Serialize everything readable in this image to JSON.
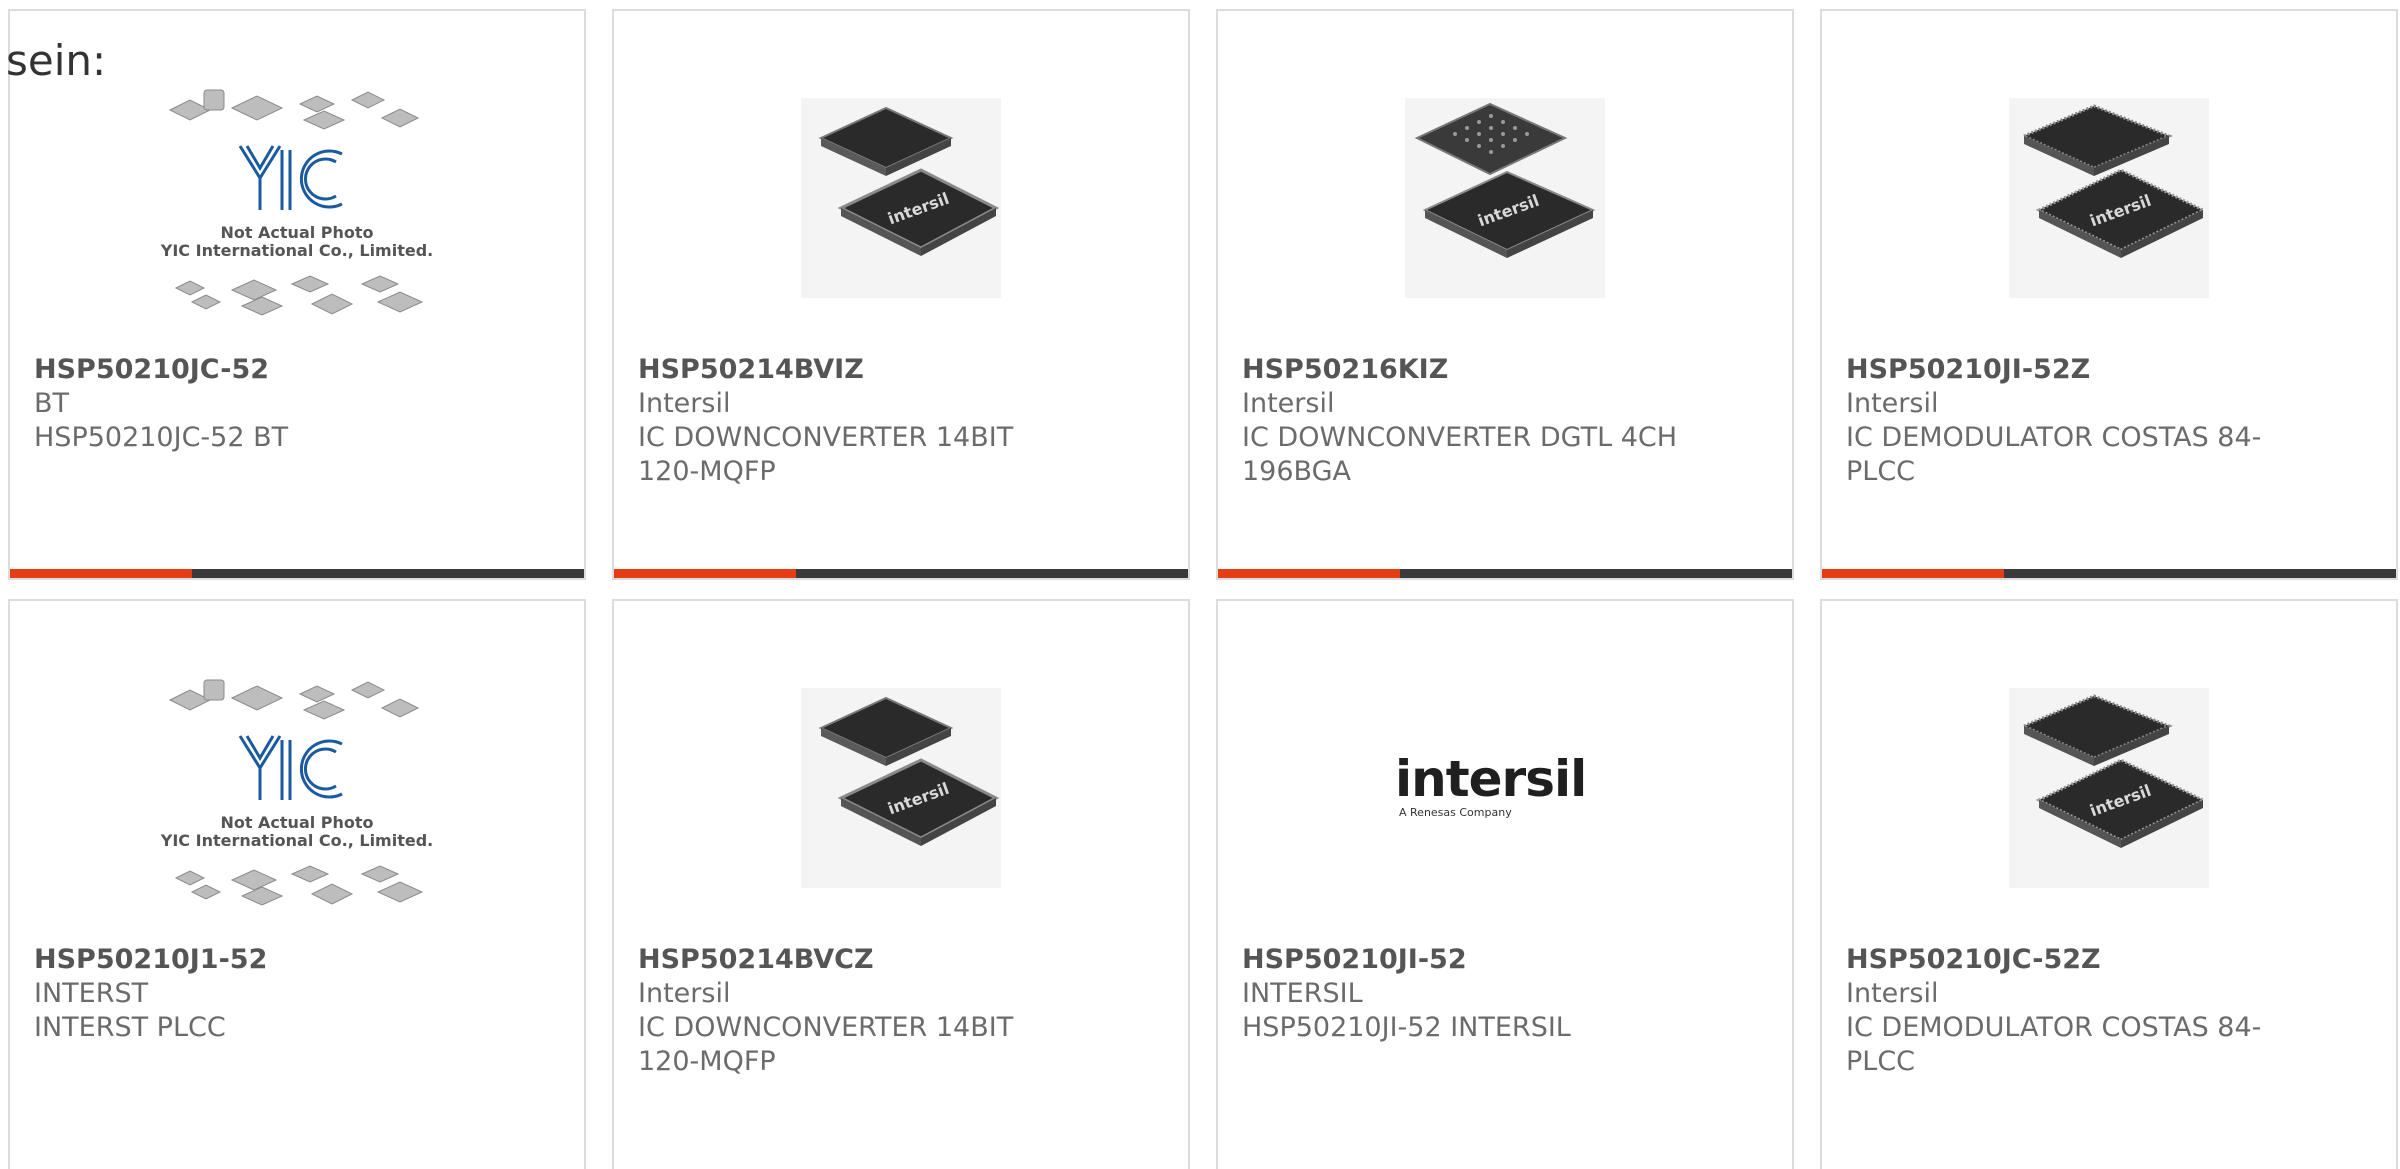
{
  "heading": "sein:",
  "accent_color": "#e63e14",
  "bar_color": "#3a3a3a",
  "yic_photo": {
    "brand": "YIC",
    "line1": "Not Actual Photo",
    "line2": "YIC International Co., Limited."
  },
  "intersil_logo": {
    "brand": "intersil",
    "tagline": "A Renesas Company"
  },
  "chip_marking": "intersil",
  "products": [
    {
      "part": "HSP50210JC-52",
      "maker": "BT",
      "desc": "HSP50210JC-52 BT",
      "image": "yic-placeholder"
    },
    {
      "part": "HSP50214BVIZ",
      "maker": "Intersil",
      "desc": "IC DOWNCONVERTER 14BIT 120-MQFP",
      "image": "qfp-chip"
    },
    {
      "part": "HSP50216KIZ",
      "maker": "Intersil",
      "desc": "IC DOWNCONVERTER DGTL 4CH 196BGA",
      "image": "bga-chip"
    },
    {
      "part": "HSP50210JI-52Z",
      "maker": "Intersil",
      "desc": "IC DEMODULATOR COSTAS 84-PLCC",
      "image": "plcc-chip"
    },
    {
      "part": "HSP50210J1-52",
      "maker": "INTERST",
      "desc": "INTERST PLCC",
      "image": "yic-placeholder"
    },
    {
      "part": "HSP50214BVCZ",
      "maker": "Intersil",
      "desc": "IC DOWNCONVERTER 14BIT 120-MQFP",
      "image": "qfp-chip"
    },
    {
      "part": "HSP50210JI-52",
      "maker": "INTERSIL",
      "desc": "HSP50210JI-52 INTERSIL",
      "image": "intersil-logo"
    },
    {
      "part": "HSP50210JC-52Z",
      "maker": "Intersil",
      "desc": "IC DEMODULATOR COSTAS 84-PLCC",
      "image": "plcc-chip"
    }
  ]
}
